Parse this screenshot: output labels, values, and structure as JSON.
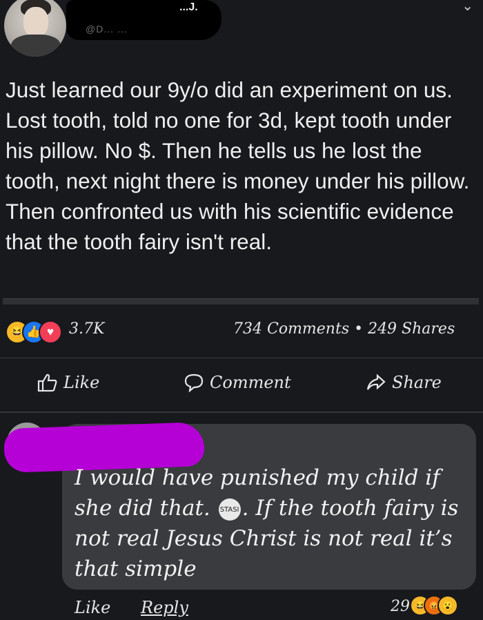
{
  "post": {
    "author_tail": "...J.",
    "handle": "@D... ...",
    "text": "Just learned our 9y/o did an experiment on us.  Lost tooth, told no one for 3d, kept tooth under his pillow.  No $.  Then he tells us he lost the tooth, next night there is money under his pillow.  Then confronted us with his scientific evidence that the tooth fairy isn't real."
  },
  "stats": {
    "reactions_count": "3.7K",
    "comments_shares": "734 Comments • 249 Shares",
    "reaction_icons": [
      "haha-icon",
      "like-icon",
      "love-icon"
    ]
  },
  "actions": {
    "like": "Like",
    "comment": "Comment",
    "share": "Share"
  },
  "comment": {
    "text_part1": "I would have punished my child if she did that.",
    "emoji_label": "STASI",
    "text_part2": ". If the tooth fairy is not real Jesus Christ is not real it’s that simple",
    "like_label": "Like",
    "reply_label": "Reply",
    "reaction_count": "29",
    "reaction_icons": [
      "haha-icon",
      "angry-icon",
      "wow-icon"
    ]
  },
  "colors": {
    "background": "#18191d",
    "bubble": "#3a3b3f",
    "scribble": "#b500d6",
    "love": "#f33e58",
    "like": "#1877f2",
    "haha": "#f7b928"
  }
}
